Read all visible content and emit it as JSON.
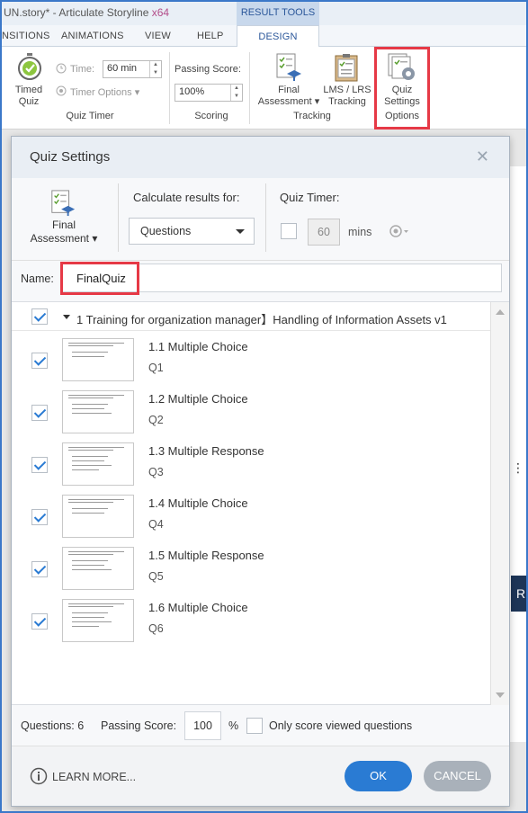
{
  "window": {
    "title_prefix": "UN.story* - Articulate Storyline ",
    "title_suffix": "x64",
    "context_tab": "RESULT TOOLS"
  },
  "tabs": [
    "NSITIONS",
    "ANIMATIONS",
    "VIEW",
    "HELP",
    "DESIGN"
  ],
  "ribbon": {
    "timed_quiz_label_1": "Timed",
    "timed_quiz_label_2": "Quiz",
    "time_label": "Time:",
    "time_value": "60 min",
    "timer_options_label": "Timer Options",
    "quiz_timer_group": "Quiz Timer",
    "passing_score_label": "Passing Score:",
    "passing_score_value": "100%",
    "scoring_group": "Scoring",
    "final_assessment_1": "Final",
    "final_assessment_2": "Assessment",
    "lms_label_1": "LMS / LRS",
    "lms_label_2": "Tracking",
    "tracking_group": "Tracking",
    "quiz_settings_1": "Quiz",
    "quiz_settings_2": "Settings",
    "options_group": "Options"
  },
  "dialog": {
    "title": "Quiz Settings",
    "close_glyph": "✕",
    "final_assessment_1": "Final",
    "final_assessment_2": "Assessment",
    "calc_label": "Calculate results for:",
    "calc_value": "Questions",
    "timer_label": "Quiz Timer:",
    "timer_value": "60",
    "timer_unit": "mins",
    "name_label": "Name:",
    "name_value": "FinalQuiz",
    "scene_title": "1 Training for organization manager】Handling of Information Assets v1",
    "questions": [
      {
        "title": "1.1 Multiple Choice",
        "sub": "Q1"
      },
      {
        "title": "1.2 Multiple Choice",
        "sub": "Q2"
      },
      {
        "title": "1.3 Multiple Response",
        "sub": "Q3"
      },
      {
        "title": "1.4 Multiple Choice",
        "sub": "Q4"
      },
      {
        "title": "1.5 Multiple Response",
        "sub": "Q5"
      },
      {
        "title": "1.6 Multiple Choice",
        "sub": "Q6"
      }
    ],
    "questions_count_label": "Questions: 6",
    "passing_score_label": "Passing Score:",
    "passing_score_value": "100",
    "percent": "%",
    "only_viewed_label": "Only score viewed questions",
    "learn_more": "LEARN MORE...",
    "ok": "OK",
    "cancel": "CANCEL"
  },
  "background": {
    "side_letter": "R",
    "side_dots": "⋮"
  },
  "colors": {
    "accent": "#2a7bd3",
    "highlight": "#e63946",
    "cancel": "#a9b1ba"
  }
}
